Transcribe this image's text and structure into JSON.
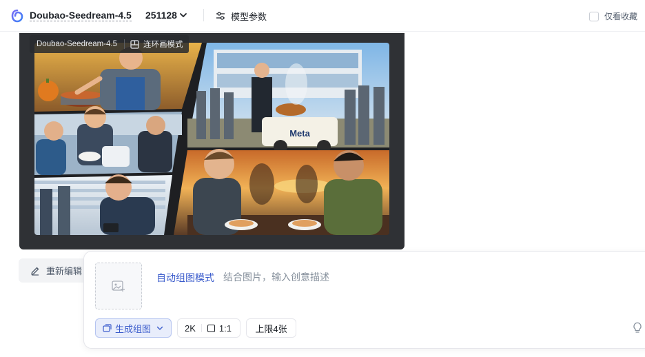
{
  "header": {
    "model_name": "Doubao-Seedream-4.5",
    "model_version": "251128",
    "params_label": "模型参数",
    "favorites_label": "仅看收藏"
  },
  "image_card": {
    "tag_model": "Doubao-Seedream-4.5",
    "tag_mode": "连环画模式",
    "image_text": "Meta"
  },
  "actions": {
    "reedit_label": "重新编辑"
  },
  "prompt": {
    "mode_label": "自动组图模式",
    "placeholder": "结合图片，输入创意描述",
    "value": ""
  },
  "options": {
    "generate_label": "生成组图",
    "resolution": "2K",
    "ratio": "1:1",
    "limit": "上限4张"
  },
  "colors": {
    "accent": "#3b5ccc",
    "image_frame": "#2f3135"
  }
}
